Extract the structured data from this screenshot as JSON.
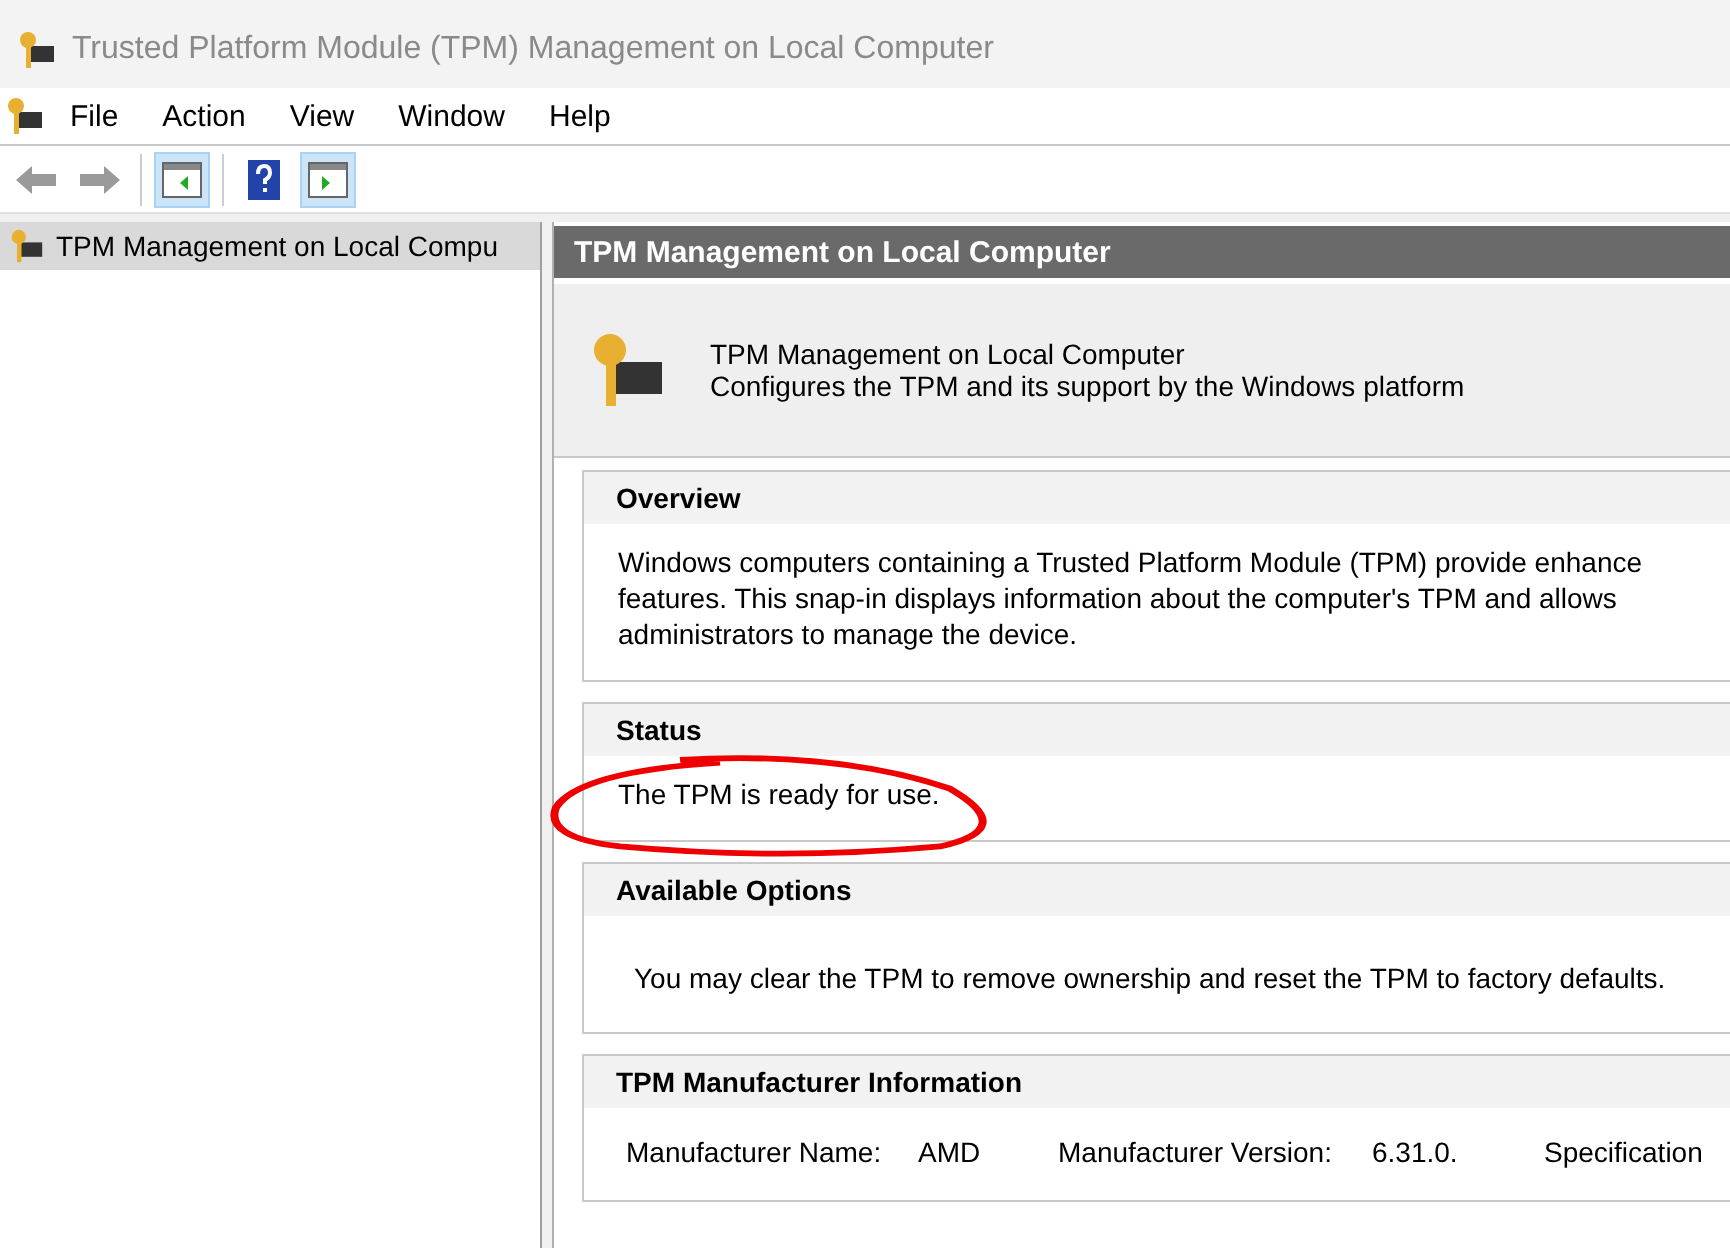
{
  "window": {
    "title": "Trusted Platform Module (TPM) Management on Local Computer"
  },
  "menu": [
    "File",
    "Action",
    "View",
    "Window",
    "Help"
  ],
  "toolbar": [
    {
      "buttons": [
        {
          "kind": "back",
          "selected": false
        },
        {
          "kind": "forward",
          "selected": false
        }
      ]
    },
    {
      "buttons": [
        {
          "kind": "tree",
          "selected": true
        }
      ]
    },
    {
      "buttons": [
        {
          "kind": "help",
          "selected": false
        },
        {
          "kind": "action",
          "selected": true
        }
      ]
    }
  ],
  "tree": {
    "items": [
      {
        "label": "TPM Management on Local Compu",
        "selected": true
      }
    ]
  },
  "content": {
    "header": "TPM Management on Local Computer",
    "info": {
      "title": "TPM Management on Local Computer",
      "description": "Configures the TPM and its support by the Windows platform"
    },
    "sections": [
      {
        "kind": "text",
        "title": "Overview",
        "text": "Windows computers containing a Trusted Platform Module (TPM) provide enhance features. This snap-in displays information about the computer's TPM and allows administrators to manage the device."
      },
      {
        "kind": "status",
        "title": "Status",
        "text": "The TPM is ready for use."
      },
      {
        "kind": "options",
        "title": "Available Options",
        "text": "You may clear the TPM to remove ownership and reset the TPM to factory defaults."
      },
      {
        "kind": "fields",
        "title": "TPM Manufacturer Information",
        "fields": [
          {
            "label": "Manufacturer Name:",
            "value": "AMD"
          },
          {
            "label": "Manufacturer Version:",
            "value": "6.31.0."
          },
          {
            "label": "Specification"
          }
        ]
      }
    ]
  }
}
